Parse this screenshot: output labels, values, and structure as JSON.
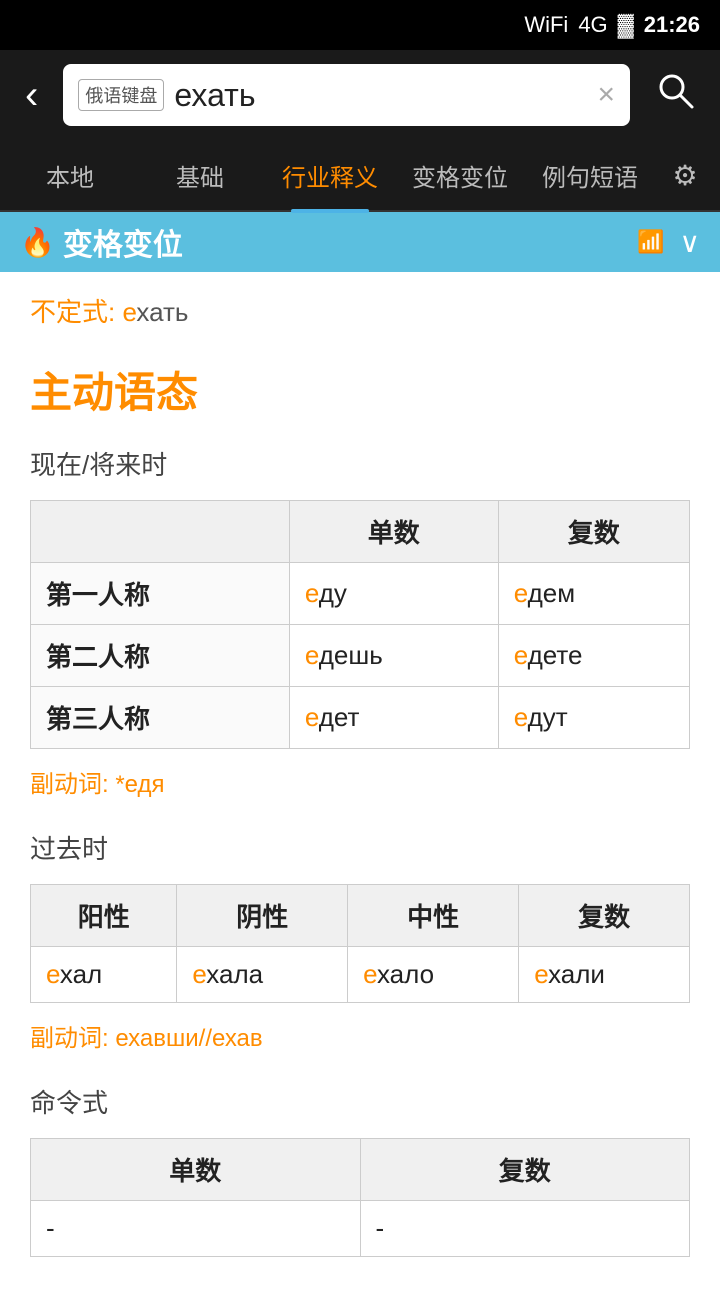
{
  "statusBar": {
    "signal": "WiFi",
    "network": "4G/2G",
    "battery": "🔋",
    "time": "21:26"
  },
  "topBar": {
    "backLabel": "‹",
    "keyboardTag": "俄语键盘",
    "searchText": "ехать",
    "clearLabel": "×",
    "searchIconLabel": "🔍"
  },
  "tabs": [
    {
      "label": "本地",
      "active": false
    },
    {
      "label": "基础",
      "active": false
    },
    {
      "label": "行业释义",
      "active": true
    },
    {
      "label": "变格变位",
      "active": false
    },
    {
      "label": "例句短语",
      "active": false
    }
  ],
  "settingsLabel": "⚙",
  "sectionHeader": {
    "icon": "🔥",
    "title": "变格变位",
    "wifiIcon": "📶",
    "collapseIcon": "∨"
  },
  "infinitive": {
    "label": "不定式:",
    "prefix": "е",
    "rest": "хать"
  },
  "voiceTitle": "主动语态",
  "presentTense": {
    "label": "现在/将来时",
    "headers": [
      "",
      "单数",
      "复数"
    ],
    "rows": [
      {
        "person": "第一人称",
        "singular_prefix": "е",
        "singular_rest": "ду",
        "plural_prefix": "е",
        "plural_rest": "дем"
      },
      {
        "person": "第二人称",
        "singular_prefix": "е",
        "singular_rest": "дешь",
        "plural_prefix": "е",
        "plural_rest": "дете"
      },
      {
        "person": "第三人称",
        "singular_prefix": "е",
        "singular_rest": "дет",
        "plural_prefix": "е",
        "plural_rest": "дут"
      }
    ],
    "participle": {
      "label": "副动词:",
      "prefix": "*е",
      "rest": "дя"
    }
  },
  "pastTense": {
    "label": "过去时",
    "headers": [
      "阳性",
      "阴性",
      "中性",
      "复数"
    ],
    "row": [
      {
        "prefix": "е",
        "rest": "хал"
      },
      {
        "prefix": "е",
        "rest": "хала"
      },
      {
        "prefix": "е",
        "rest": "хало"
      },
      {
        "prefix": "е",
        "rest": "хали"
      }
    ],
    "participle": {
      "label": "副动词:",
      "text1_prefix": "е",
      "text1_rest": "хавши//",
      "text2_prefix": "е",
      "text2_rest": "хав"
    }
  },
  "imperativeTense": {
    "label": "命令式",
    "headers": [
      "单数",
      "复数"
    ],
    "row": [
      {
        "value": "-"
      },
      {
        "value": "-"
      }
    ]
  }
}
